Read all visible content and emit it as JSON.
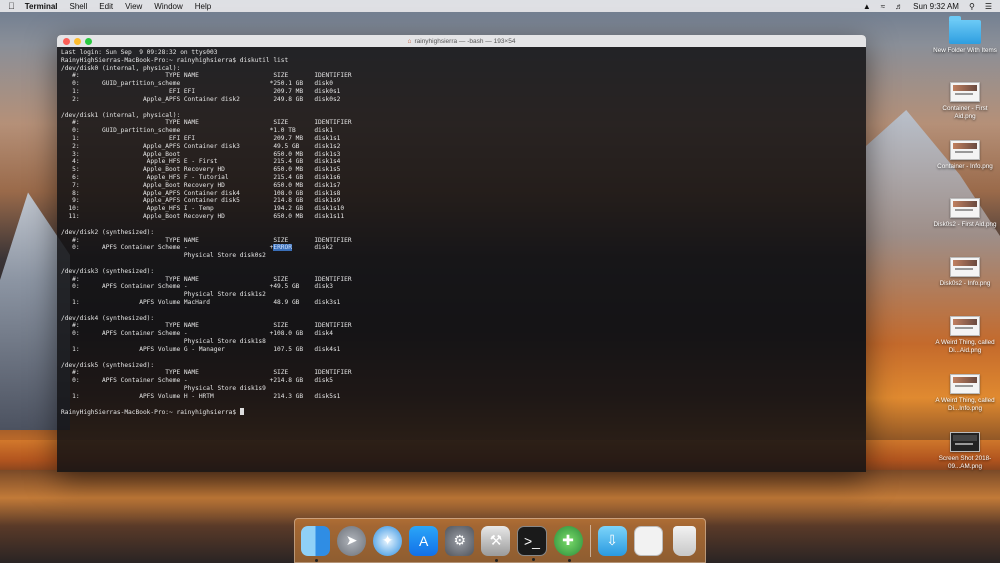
{
  "menubar": {
    "app_name": "Terminal",
    "menus": [
      "Shell",
      "Edit",
      "View",
      "Window",
      "Help"
    ],
    "clock": "Sun 9:32 AM"
  },
  "terminal": {
    "title": "rainyhighsierra — -bash — 193×54",
    "lines": [
      "Last login: Sun Sep  9 09:28:32 on ttys003",
      "RainyHighSierras-MacBook-Pro:~ rainyhighsierra$ diskutil list",
      "/dev/disk0 (internal, physical):",
      "   #:                       TYPE NAME                    SIZE       IDENTIFIER",
      "   0:      GUID_partition_scheme                        *250.1 GB   disk0",
      "   1:                        EFI EFI                     209.7 MB   disk0s1",
      "   2:                 Apple_APFS Container disk2         249.8 GB   disk0s2",
      "",
      "/dev/disk1 (internal, physical):",
      "   #:                       TYPE NAME                    SIZE       IDENTIFIER",
      "   0:      GUID_partition_scheme                        *1.0 TB     disk1",
      "   1:                        EFI EFI                     209.7 MB   disk1s1",
      "   2:                 Apple_APFS Container disk3         49.5 GB    disk1s2",
      "   3:                 Apple_Boot                         650.0 MB   disk1s3",
      "   4:                  Apple_HFS E - First               215.4 GB   disk1s4",
      "   5:                 Apple_Boot Recovery HD             650.0 MB   disk1s5",
      "   6:                  Apple_HFS F - Tutorial            215.4 GB   disk1s6",
      "   7:                 Apple_Boot Recovery HD             650.0 MB   disk1s7",
      "   8:                 Apple_APFS Container disk4         108.0 GB   disk1s8",
      "   9:                 Apple_APFS Container disk5         214.8 GB   disk1s9",
      "  10:                  Apple_HFS I - Temp                194.2 GB   disk1s10",
      "  11:                 Apple_Boot Recovery HD             650.0 MB   disk1s11",
      "",
      "/dev/disk2 (synthesized):",
      "   #:                       TYPE NAME                    SIZE       IDENTIFIER",
      "   0:      APFS Container Scheme -                      +",
      "                                 Physical Store disk0s2",
      "",
      "/dev/disk3 (synthesized):",
      "   #:                       TYPE NAME                    SIZE       IDENTIFIER",
      "   0:      APFS Container Scheme -                      +49.5 GB    disk3",
      "                                 Physical Store disk1s2",
      "   1:                APFS Volume MacHard                 48.9 GB    disk3s1",
      "",
      "/dev/disk4 (synthesized):",
      "   #:                       TYPE NAME                    SIZE       IDENTIFIER",
      "   0:      APFS Container Scheme -                      +108.0 GB   disk4",
      "                                 Physical Store disk1s8",
      "   1:                APFS Volume G - Manager             107.5 GB   disk4s1",
      "",
      "/dev/disk5 (synthesized):",
      "   #:                       TYPE NAME                    SIZE       IDENTIFIER",
      "   0:      APFS Container Scheme -                      +214.8 GB   disk5",
      "                                 Physical Store disk1s9",
      "   1:                APFS Volume H - HRTM                214.3 GB   disk5s1",
      "",
      "RainyHighSierras-MacBook-Pro:~ rainyhighsierra$ "
    ],
    "error_value": "ERROR",
    "error_tail": "      disk2"
  },
  "desktop_icons": [
    {
      "label": "New Folder With Items",
      "kind": "folder"
    },
    {
      "label": "Container - First Aid.png",
      "kind": "image"
    },
    {
      "label": "Container - Info.png",
      "kind": "image"
    },
    {
      "label": "Disk0s2 - First Aid.png",
      "kind": "image"
    },
    {
      "label": "Disk0s2 - Info.png",
      "kind": "image"
    },
    {
      "label": "A Weird Thing, called Di...Aid.png",
      "kind": "image"
    },
    {
      "label": "A Weird Thing, called Di...Info.png",
      "kind": "image"
    },
    {
      "label": "Screen Shot 2018-09...AM.png",
      "kind": "screenshot"
    }
  ],
  "dock": {
    "items": [
      "finder",
      "launchpad",
      "safari",
      "app-store",
      "system-preferences",
      "disk-utility-helper",
      "terminal",
      "disk-utility",
      "downloads",
      "documents",
      "trash"
    ]
  }
}
